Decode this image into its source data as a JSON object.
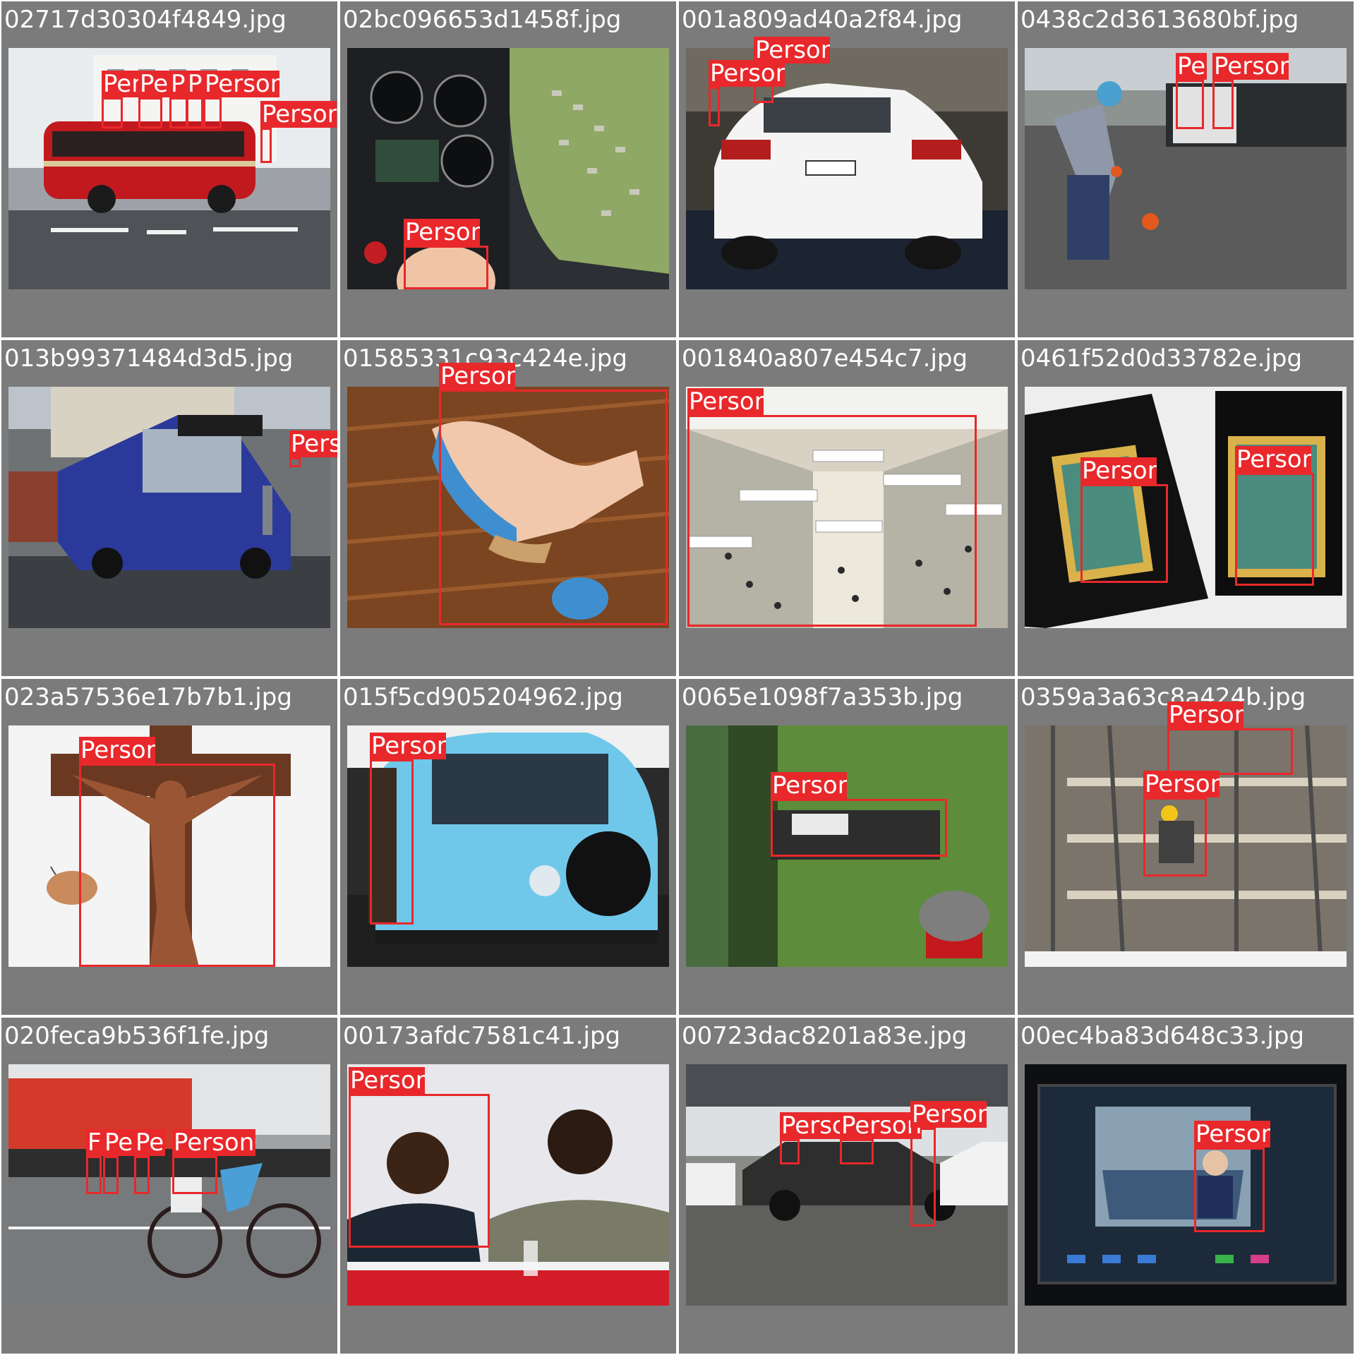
{
  "colors": {
    "tile_background": "#7b7b7b",
    "box_color": "#e8282b",
    "label_text": "#ffffff"
  },
  "tiles": [
    {
      "filename": "02717d30304f4849.jpg",
      "scene": "red-bus",
      "boxes": [
        {
          "label": "Per"
        },
        {
          "label": "Pe"
        },
        {
          "label": "P"
        },
        {
          "label": "P"
        },
        {
          "label": "Person"
        },
        {
          "label": "Person"
        }
      ]
    },
    {
      "filename": "02bc096653d1458f.jpg",
      "scene": "cockpit",
      "boxes": [
        {
          "label": "Person"
        }
      ]
    },
    {
      "filename": "001a809ad40a2f84.jpg",
      "scene": "white-car",
      "boxes": [
        {
          "label": "Person"
        },
        {
          "label": "Person"
        }
      ]
    },
    {
      "filename": "0438c2d3613680bf.jpg",
      "scene": "ball-player",
      "boxes": [
        {
          "label": "Pe"
        },
        {
          "label": "Person"
        }
      ]
    },
    {
      "filename": "013b99371484d3d5.jpg",
      "scene": "blue-bus",
      "boxes": [
        {
          "label": "Person"
        }
      ]
    },
    {
      "filename": "01585331c93c424e.jpg",
      "scene": "sandal",
      "boxes": [
        {
          "label": "Person"
        }
      ]
    },
    {
      "filename": "001840a807e454c7.jpg",
      "scene": "mall",
      "boxes": [
        {
          "label": "Person"
        }
      ]
    },
    {
      "filename": "0461f52d0d33782e.jpg",
      "scene": "tarot",
      "boxes": [
        {
          "label": "Person"
        },
        {
          "label": "Person"
        }
      ]
    },
    {
      "filename": "023a57536e17b7b1.jpg",
      "scene": "crucifix",
      "boxes": [
        {
          "label": "Person"
        }
      ]
    },
    {
      "filename": "015f5cd905204962.jpg",
      "scene": "vw-van",
      "boxes": [
        {
          "label": "Person"
        }
      ]
    },
    {
      "filename": "0065e1098f7a353b.jpg",
      "scene": "lawn",
      "boxes": [
        {
          "label": "Person"
        }
      ]
    },
    {
      "filename": "0359a3a63c8a424b.jpg",
      "scene": "scaffold",
      "boxes": [
        {
          "label": "Person"
        },
        {
          "label": "Person"
        }
      ]
    },
    {
      "filename": "020feca9b536f1fe.jpg",
      "scene": "cyclist",
      "boxes": [
        {
          "label": "F"
        },
        {
          "label": "Pe"
        },
        {
          "label": "Pe"
        },
        {
          "label": "Person"
        }
      ]
    },
    {
      "filename": "00173afdc7581c41.jpg",
      "scene": "meeting",
      "boxes": [
        {
          "label": "Person"
        }
      ]
    },
    {
      "filename": "00723dac8201a83e.jpg",
      "scene": "old-car",
      "boxes": [
        {
          "label": "Persc"
        },
        {
          "label": "Person"
        },
        {
          "label": "Person"
        }
      ]
    },
    {
      "filename": "00ec4ba83d648c33.jpg",
      "scene": "screen",
      "boxes": [
        {
          "label": "Person"
        }
      ]
    }
  ]
}
